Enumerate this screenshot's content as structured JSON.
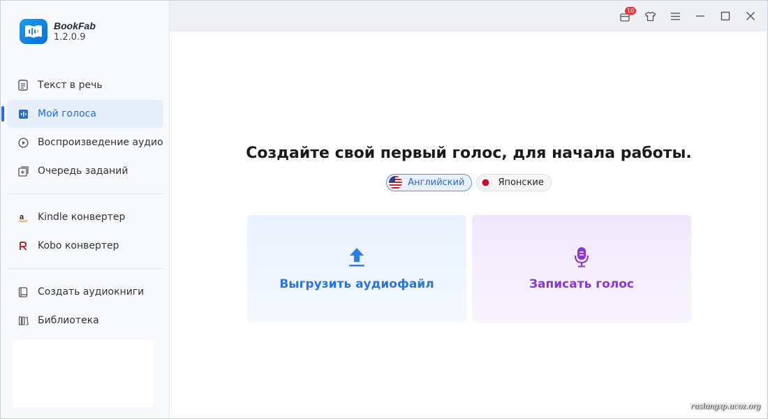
{
  "app": {
    "name": "BookFab",
    "version": "1.2.0.9"
  },
  "titlebar": {
    "notification_count": "10"
  },
  "sidebar": {
    "groups": [
      [
        {
          "label": "Текст в речь",
          "icon": "document-icon"
        },
        {
          "label": "Мой голоса",
          "icon": "voice-icon",
          "active": true
        },
        {
          "label": "Воспроизведение аудио",
          "icon": "play-circle-icon"
        },
        {
          "label": "Очередь заданий",
          "icon": "queue-add-icon"
        }
      ],
      [
        {
          "label": "Kindle конвертер",
          "icon": "amazon-icon"
        },
        {
          "label": "Kobo конвертер",
          "icon": "kobo-icon"
        }
      ],
      [
        {
          "label": "Создать аудиокниги",
          "icon": "book-icon"
        },
        {
          "label": "Библиотека",
          "icon": "library-icon"
        }
      ]
    ]
  },
  "main": {
    "heading": "Создайте свой первый голос, для начала работы.",
    "languages": [
      {
        "label": "Английский",
        "flag": "us-flag-icon",
        "selected": true
      },
      {
        "label": "Японские",
        "flag": "japan-flag-icon",
        "selected": false
      }
    ],
    "cards": {
      "upload_label": "Выгрузить аудиофайл",
      "record_label": "Записать голос"
    }
  },
  "watermark": "ruslangxp.ucoz.org",
  "colors": {
    "accent_blue": "#1f6fe0",
    "accent_purple": "#8a35d8",
    "badge_red": "#e93434"
  }
}
